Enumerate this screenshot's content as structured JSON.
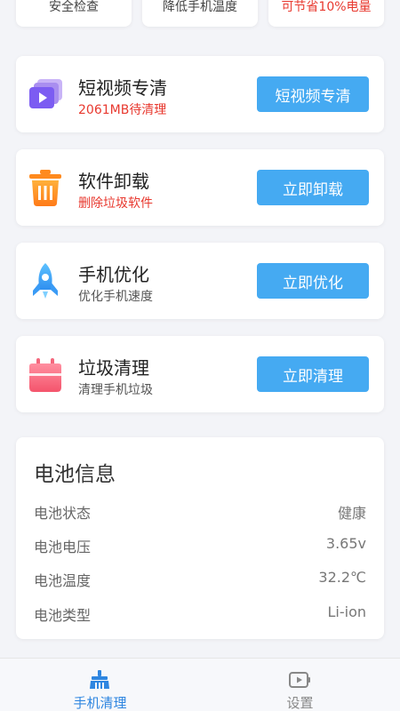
{
  "top_cards": [
    {
      "label": "安全检查"
    },
    {
      "label": "降低手机温度"
    },
    {
      "label": "可节省10%电量"
    }
  ],
  "top_edge_left": "2",
  "top_edge_right": "9",
  "cards": [
    {
      "title": "短视频专清",
      "subtitle": "2061MB待清理",
      "button": "短视频专清",
      "icon": "video-clean-icon"
    },
    {
      "title": "软件卸载",
      "subtitle": "删除垃圾软件",
      "button": "立即卸载",
      "icon": "trash-icon"
    },
    {
      "title": "手机优化",
      "subtitle": "优化手机速度",
      "button": "立即优化",
      "icon": "rocket-icon"
    },
    {
      "title": "垃圾清理",
      "subtitle": "清理手机垃圾",
      "button": "立即清理",
      "icon": "junk-bag-icon"
    }
  ],
  "battery": {
    "title": "电池信息",
    "rows": [
      {
        "label": "电池状态",
        "value": "健康"
      },
      {
        "label": "电池电压",
        "value": "3.65v"
      },
      {
        "label": "电池温度",
        "value": "32.2℃"
      },
      {
        "label": "电池类型",
        "value": "Li-ion"
      }
    ]
  },
  "nav": [
    {
      "label": "手机清理",
      "icon": "broom-icon",
      "active": true
    },
    {
      "label": "设置",
      "icon": "settings-video-icon",
      "active": false
    }
  ],
  "colors": {
    "accent": "#45aaf2",
    "warn": "#e8392f",
    "nav_active": "#2f86e0"
  }
}
